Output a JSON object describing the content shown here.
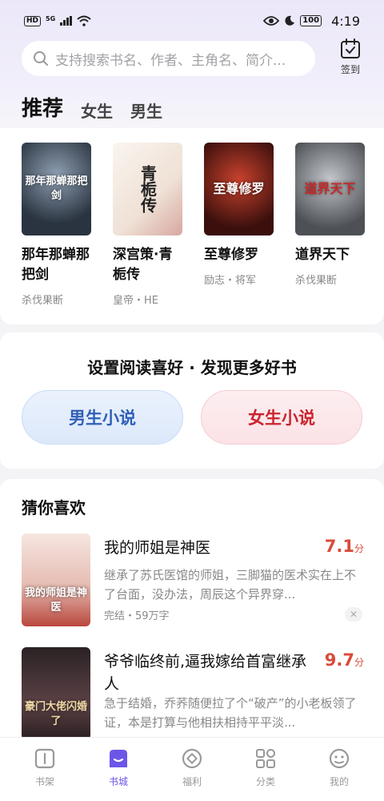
{
  "status_bar": {
    "left_badge": "HD",
    "network": "5G",
    "battery": "100",
    "time": "4:19"
  },
  "search": {
    "placeholder": "支持搜索书名、作者、主角名、简介..."
  },
  "checkin": {
    "label": "签到"
  },
  "tabs": [
    {
      "label": "推荐",
      "active": true
    },
    {
      "label": "女生",
      "active": false
    },
    {
      "label": "男生",
      "active": false
    }
  ],
  "recommended_books": [
    {
      "title": "那年那蝉那把剑",
      "cover_text": "那年那蝉那把剑",
      "tags": "杀伐果断",
      "cover_color": "#3b4756"
    },
    {
      "title": "深宫策·青栀传",
      "cover_text": "青栀传",
      "tags": "皇帝・HE",
      "cover_color": "#f3ebe3"
    },
    {
      "title": "至尊修罗",
      "cover_text": "至尊修罗",
      "tags": "励志・将军",
      "cover_color": "#5a1a16"
    },
    {
      "title": "道界天下",
      "cover_text": "道界天下",
      "tags": "杀伐果断",
      "cover_color": "#6d6f72"
    }
  ],
  "preference": {
    "title": "设置阅读喜好 · 发现更多好书",
    "male_label": "男生小说",
    "female_label": "女生小说"
  },
  "guess": {
    "title": "猜你喜欢",
    "items": [
      {
        "name": "我的师姐是神医",
        "score": "7.1",
        "unit": "分",
        "desc": "继承了苏氏医馆的师姐，三脚猫的医术实在上不了台面，没办法，周辰这个异界穿...",
        "meta": "完结・59万字",
        "cover_text": "我的师姐是神医",
        "cover_color": "#e9c9c0"
      },
      {
        "name": "爷爷临终前,逼我嫁给首富继承人",
        "score": "9.7",
        "unit": "分",
        "desc": "急于结婚，乔荞随便拉了个“破产”的小老板领了证，本是打算与他相扶相持平平淡...",
        "meta": "",
        "cover_text": "豪门大佬闪婚了",
        "cover_color": "#3a2c2e"
      }
    ]
  },
  "bottom_nav": [
    {
      "label": "书架",
      "icon": "bookshelf-icon",
      "active": false
    },
    {
      "label": "书城",
      "icon": "bookstore-icon",
      "active": true
    },
    {
      "label": "福利",
      "icon": "welfare-icon",
      "active": false
    },
    {
      "label": "分类",
      "icon": "category-icon",
      "active": false
    },
    {
      "label": "我的",
      "icon": "profile-icon",
      "active": false
    }
  ],
  "colors": {
    "accent": "#6b56e8",
    "score_red": "#d84b3a",
    "male_blue": "#2f5fb8",
    "female_red": "#c9252f"
  }
}
